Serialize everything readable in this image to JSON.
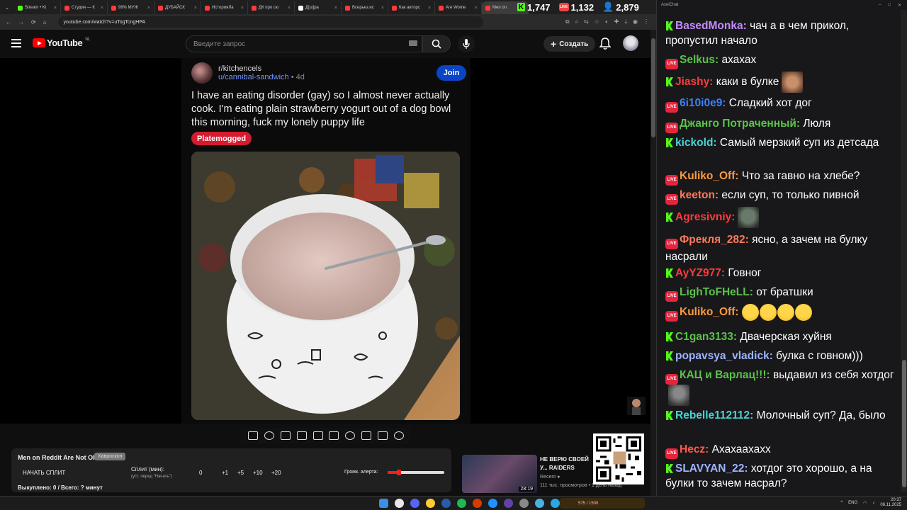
{
  "browser": {
    "tabs": [
      {
        "label": "Stream • Ki",
        "color": "#53fc18",
        "active": false
      },
      {
        "label": "Студия — К",
        "color": "#ff3b3b",
        "active": false
      },
      {
        "label": "99% МУЖ",
        "color": "#ff3b3b",
        "active": false
      },
      {
        "label": "ДУБАЙСК",
        "color": "#ff3b3b",
        "active": false
      },
      {
        "label": "ИсторияЛа",
        "color": "#ff3b3b",
        "active": false
      },
      {
        "label": "ДК про сю",
        "color": "#ff3b3b",
        "active": false
      },
      {
        "label": "Д[ш]ра",
        "color": "#ffffff",
        "active": false
      },
      {
        "label": "Всерьез.ис",
        "color": "#ff3b3b",
        "active": false
      },
      {
        "label": "Как авторс",
        "color": "#ff3b3b",
        "active": false
      },
      {
        "label": "Are Wome",
        "color": "#ff3b3b",
        "active": false
      },
      {
        "label": "Men on",
        "color": "#ff3b3b",
        "active": true
      }
    ],
    "url": "youtube.com/watch?v=uTogTcngHPA"
  },
  "stream_stats": {
    "kick_viewers": "1,747",
    "live_viewers": "1,132",
    "total_viewers": "2,879"
  },
  "youtube": {
    "logo_text": "YouTube",
    "region": "NL",
    "search_placeholder": "Введите запрос",
    "create_label": "Создать"
  },
  "reddit_post": {
    "subreddit": "r/kitchencels",
    "user": "u/cannibal-sandwich",
    "age": "• 4d",
    "join_label": "Join",
    "title": "I have an eating disorder (gay) so I almost never actually cook. I'm eating plain strawberry yogurt out of a dog bowl this morning, fuck my lonely puppy life",
    "flair": "Platemogged"
  },
  "player_controls": [
    "loop-icon",
    "broadcast-icon",
    "miniplayer-icon",
    "clapper-icon",
    "theater-icon",
    "subtitles-icon",
    "speed-icon",
    "playlist-add-icon",
    "screenshot-icon",
    "settings-icon"
  ],
  "split_panel": {
    "title": "Men on Reddit Are Not Ok",
    "tag": "Хавроскоп",
    "start_label": "НАЧАТЬ СПЛИТ",
    "split_label": "Сплит (мин):",
    "split_hint": "(уст. перед \"Начать\")",
    "split_value": "0",
    "buttons": [
      "+1",
      "+5",
      "+10",
      "+20"
    ],
    "alert_label": "Громк. алерта:",
    "alert_level": 0.2,
    "sold_label": "Выкуплено: 0 / Всего: ? минут"
  },
  "recommendation": {
    "title": "НЕ ВЕРЮ СВОЕЙ У... RAIDERS",
    "channel": "Recent",
    "meta": "111 тыс. просмотров • 1 день назад",
    "duration": "28:19"
  },
  "chat": {
    "app_title": "AxelChat",
    "messages": [
      {
        "platform": "kick",
        "user": "BasedMonka",
        "color": "#c48cff",
        "text": "чач а в чем прикол, пропустил начало"
      },
      {
        "platform": "live",
        "user": "Selkus",
        "color": "#5cc24a",
        "text": "ахахах"
      },
      {
        "platform": "kick",
        "user": "Jiashy",
        "color": "#ff3b3b",
        "text": "каки в булке",
        "emote": true
      },
      {
        "platform": "live",
        "user": "6i10i0e9",
        "color": "#3f7fff",
        "text": "Сладкий хот дог"
      },
      {
        "platform": "live",
        "user": "Джанго Потраченный",
        "color": "#5cc24a",
        "text": "Люля"
      },
      {
        "platform": "kick",
        "user": "kickold",
        "color": "#4ad3d3",
        "text": "Самый мерзкий суп из детсада"
      },
      {
        "platform": "live",
        "user": "Kuliko_Off",
        "color": "#ff9a3c",
        "text": "Что за гавно на хлебе?"
      },
      {
        "platform": "live",
        "user": "keeton",
        "color": "#ff7a5a",
        "text": "если суп, то только пивной"
      },
      {
        "platform": "kick",
        "user": "Agresivniy",
        "color": "#ff3b3b",
        "text": "",
        "emote": true
      },
      {
        "platform": "live",
        "user": "Фрекля_282",
        "color": "#ff7a5a",
        "text": "ясно, а зачем на булку насрали"
      },
      {
        "platform": "kick",
        "user": "AyYZ977",
        "color": "#ff3b3b",
        "text": "Говног"
      },
      {
        "platform": "live",
        "user": "LighToFHeLL",
        "color": "#5cc24a",
        "text": "от братшки"
      },
      {
        "platform": "live",
        "user": "Kuliko_Off",
        "color": "#ff9a3c",
        "text": "",
        "laughs": 4
      },
      {
        "platform": "kick",
        "user": "C1gan3133",
        "color": "#5cc24a",
        "text": "Двачерская хуйня"
      },
      {
        "platform": "kick",
        "user": "popavsya_vladick",
        "color": "#9db4ff",
        "text": "булка с говном)))"
      },
      {
        "platform": "live",
        "user": "КАЦ и Варлац!!!",
        "color": "#5cc24a",
        "text": "выдавил из себя хотдог",
        "emote": true
      },
      {
        "platform": "kick",
        "user": "Rebelle112112",
        "color": "#4ad3d3",
        "text": "Молочный суп? Да, было"
      },
      {
        "platform": "live",
        "user": "Hecz",
        "color": "#ff5a4a",
        "text": "Ахахаахахх"
      },
      {
        "platform": "kick",
        "user": "SLAVYAN_22",
        "color": "#9db4ff",
        "text": "хотдог это хорошо, а на булки то зачем насрал?"
      }
    ]
  },
  "taskbar": {
    "kick_widget": "575 / 1500",
    "lang": "ENG",
    "time": "20:37",
    "date": "06.11.2025"
  }
}
